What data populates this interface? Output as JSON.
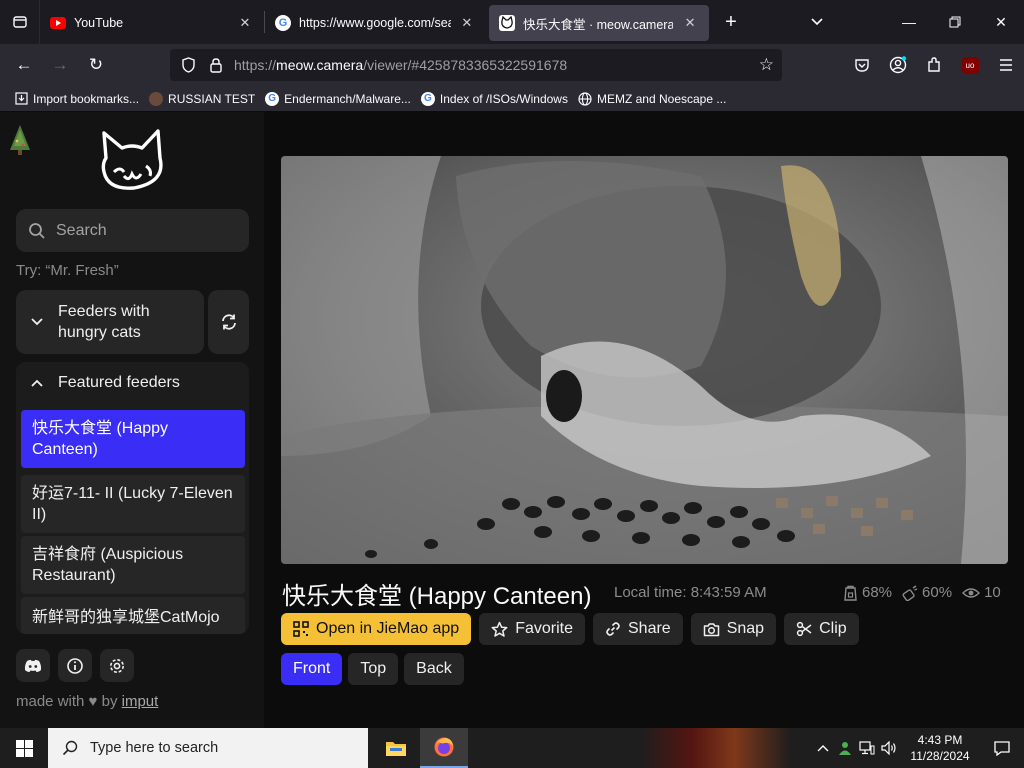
{
  "browser": {
    "tabs": [
      {
        "title": "YouTube",
        "icon": "youtube-icon",
        "active": false
      },
      {
        "title": "https://www.google.com/search",
        "icon": "google-icon",
        "active": false
      },
      {
        "title": "快乐大食堂 · meow.camera",
        "icon": "cat-icon",
        "active": true
      }
    ],
    "url_prefix": "https://",
    "url_host": "meow.camera",
    "url_path": "/viewer/#4258783365322591678",
    "bookmarks": [
      {
        "label": "Import bookmarks...",
        "icon": "import-icon"
      },
      {
        "label": "RUSSIAN TEST",
        "icon": "avatar-icon"
      },
      {
        "label": "Endermanch/Malware...",
        "icon": "google-icon"
      },
      {
        "label": "Index of /ISOs/Windows",
        "icon": "google-icon"
      },
      {
        "label": "MEMZ and Noescape ...",
        "icon": "globe-icon"
      }
    ],
    "extension_badge": "uo"
  },
  "sidebar": {
    "search_placeholder": "Search",
    "hint": "Try: “Mr. Fresh”",
    "hungry_label": "Feeders with hungry cats",
    "featured_label": "Featured feeders",
    "feeders": [
      {
        "name": "快乐大食堂 (Happy Canteen)",
        "selected": true
      },
      {
        "name": "好运7-11- II  (Lucky 7-Eleven II)",
        "selected": false
      },
      {
        "name": "吉祥食府 (Auspicious Restaurant)",
        "selected": false
      },
      {
        "name": "新鲜哥的独享城堡CatMojo",
        "selected": false
      }
    ],
    "made_with_prefix": "made with",
    "made_with_by": "by",
    "made_with_link": "imput"
  },
  "viewer": {
    "title": "快乐大食堂 (Happy Canteen)",
    "local_time": "Local time: 8:43:59 AM",
    "stats": {
      "food": "68%",
      "battery": "60%",
      "viewers": "10"
    },
    "actions": {
      "open_app": "Open in JieMao app",
      "favorite": "Favorite",
      "share": "Share",
      "snap": "Snap",
      "clip": "Clip"
    },
    "views": {
      "front": "Front",
      "top": "Top",
      "back": "Back"
    }
  },
  "taskbar": {
    "search_placeholder": "Type here to search",
    "time": "4:43 PM",
    "date": "11/28/2024"
  },
  "colors": {
    "accent_blue": "#3a2df5",
    "accent_yellow": "#f6c036",
    "youtube_red": "#ff0000"
  }
}
